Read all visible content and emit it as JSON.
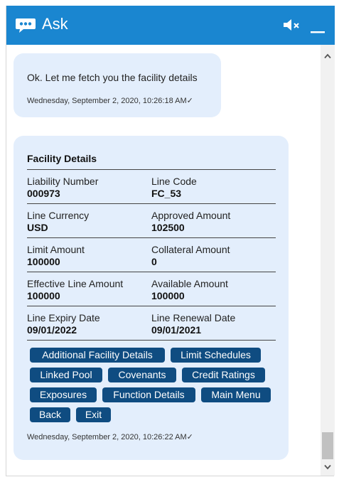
{
  "header": {
    "title": "Ask"
  },
  "messages": {
    "bot_text": "Ok. Let me fetch you the facility details",
    "bot_time": "Wednesday, September 2, 2020, 10:26:18 AM✓"
  },
  "facility": {
    "title": "Facility Details",
    "fields": [
      {
        "label": "Liability Number",
        "value": "000973"
      },
      {
        "label": "Line Code",
        "value": "FC_53"
      },
      {
        "label": "Line Currency",
        "value": "USD"
      },
      {
        "label": "Approved Amount",
        "value": "102500"
      },
      {
        "label": "Limit Amount",
        "value": "100000"
      },
      {
        "label": "Collateral Amount",
        "value": "0"
      },
      {
        "label": "Effective Line Amount",
        "value": "100000"
      },
      {
        "label": "Available Amount",
        "value": "100000"
      },
      {
        "label": "Line Expiry Date",
        "value": "09/01/2022"
      },
      {
        "label": "Line Renewal Date",
        "value": "09/01/2021"
      }
    ],
    "buttons": [
      "Additional Facility Details",
      "Limit Schedules",
      "Linked Pool",
      "Covenants",
      "Credit Ratings",
      "Exposures",
      "Function Details",
      "Main Menu",
      "Back",
      "Exit"
    ],
    "time": "Wednesday, September 2, 2020, 10:26:22 AM✓"
  },
  "colors": {
    "header": "#1a86d0",
    "bubble": "#e3eefc",
    "button": "#0f4c81"
  },
  "icons": {
    "chat": "chat-bubble-icon",
    "mute": "speaker-mute-icon",
    "minimize": "minimize-icon",
    "scroll_up": "chevron-up-icon",
    "scroll_down": "chevron-down-icon"
  }
}
